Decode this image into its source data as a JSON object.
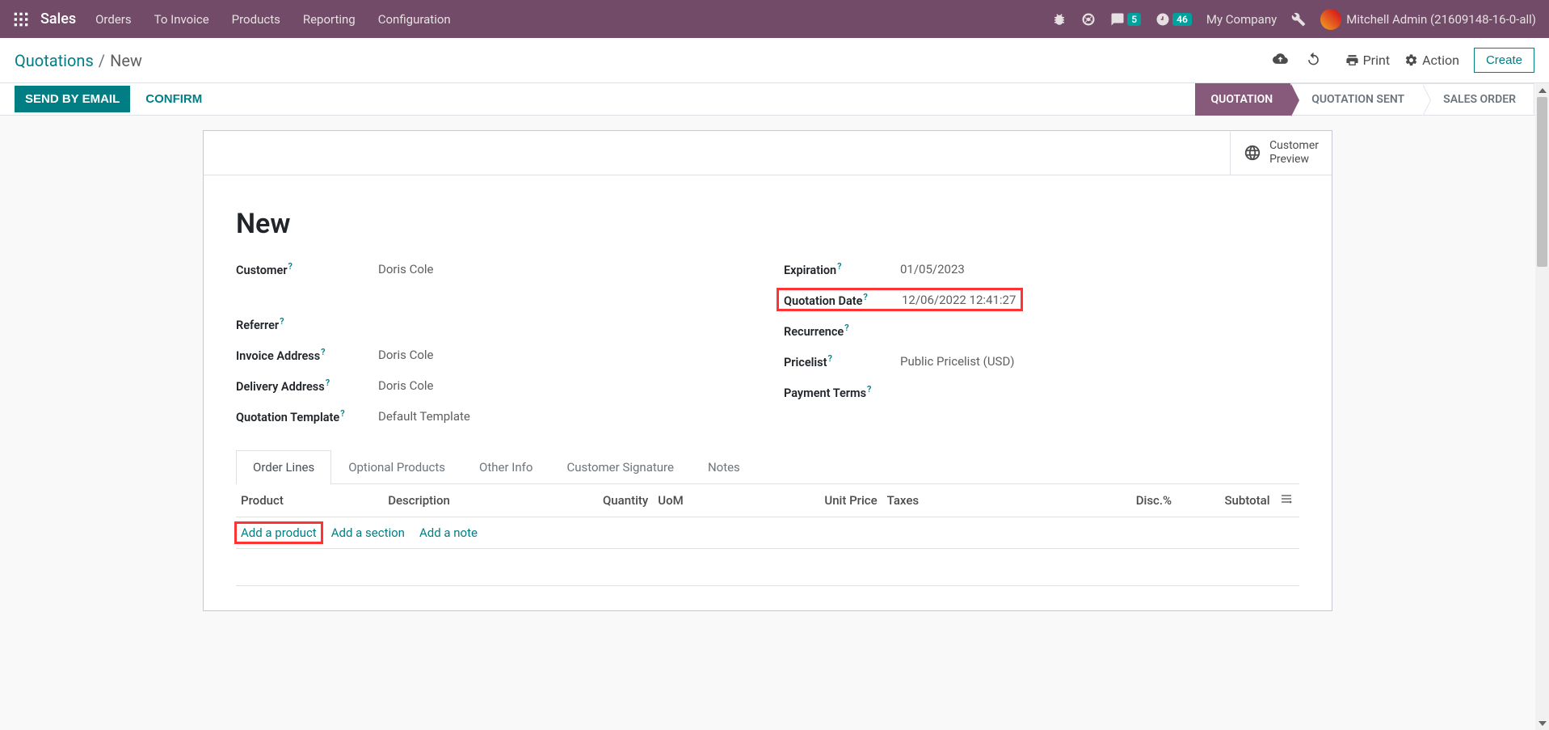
{
  "topbar": {
    "brand": "Sales",
    "menu": [
      "Orders",
      "To Invoice",
      "Products",
      "Reporting",
      "Configuration"
    ],
    "messages_badge": "5",
    "activities_badge": "46",
    "company": "My Company",
    "user": "Mitchell Admin (21609148-16-0-all)"
  },
  "actionbar": {
    "breadcrumb_link": "Quotations",
    "breadcrumb_current": "New",
    "print": "Print",
    "action": "Action",
    "create": "Create"
  },
  "statusbar": {
    "send_email": "SEND BY EMAIL",
    "confirm": "CONFIRM",
    "steps": [
      "QUOTATION",
      "QUOTATION SENT",
      "SALES ORDER"
    ]
  },
  "buttonbox": {
    "preview_l1": "Customer",
    "preview_l2": "Preview"
  },
  "form": {
    "title": "New",
    "left": {
      "customer_label": "Customer",
      "customer_value": "Doris Cole",
      "referrer_label": "Referrer",
      "referrer_value": "",
      "invoice_addr_label": "Invoice Address",
      "invoice_addr_value": "Doris Cole",
      "delivery_addr_label": "Delivery Address",
      "delivery_addr_value": "Doris Cole",
      "template_label": "Quotation Template",
      "template_value": "Default Template"
    },
    "right": {
      "expiration_label": "Expiration",
      "expiration_value": "01/05/2023",
      "quotation_date_label": "Quotation Date",
      "quotation_date_value": "12/06/2022 12:41:27",
      "recurrence_label": "Recurrence",
      "recurrence_value": "",
      "pricelist_label": "Pricelist",
      "pricelist_value": "Public Pricelist (USD)",
      "payment_terms_label": "Payment Terms",
      "payment_terms_value": ""
    }
  },
  "tabs": [
    "Order Lines",
    "Optional Products",
    "Other Info",
    "Customer Signature",
    "Notes"
  ],
  "table": {
    "headers": {
      "product": "Product",
      "description": "Description",
      "quantity": "Quantity",
      "uom": "UoM",
      "unit_price": "Unit Price",
      "taxes": "Taxes",
      "disc": "Disc.%",
      "subtotal": "Subtotal"
    },
    "add_product": "Add a product",
    "add_section": "Add a section",
    "add_note": "Add a note"
  }
}
